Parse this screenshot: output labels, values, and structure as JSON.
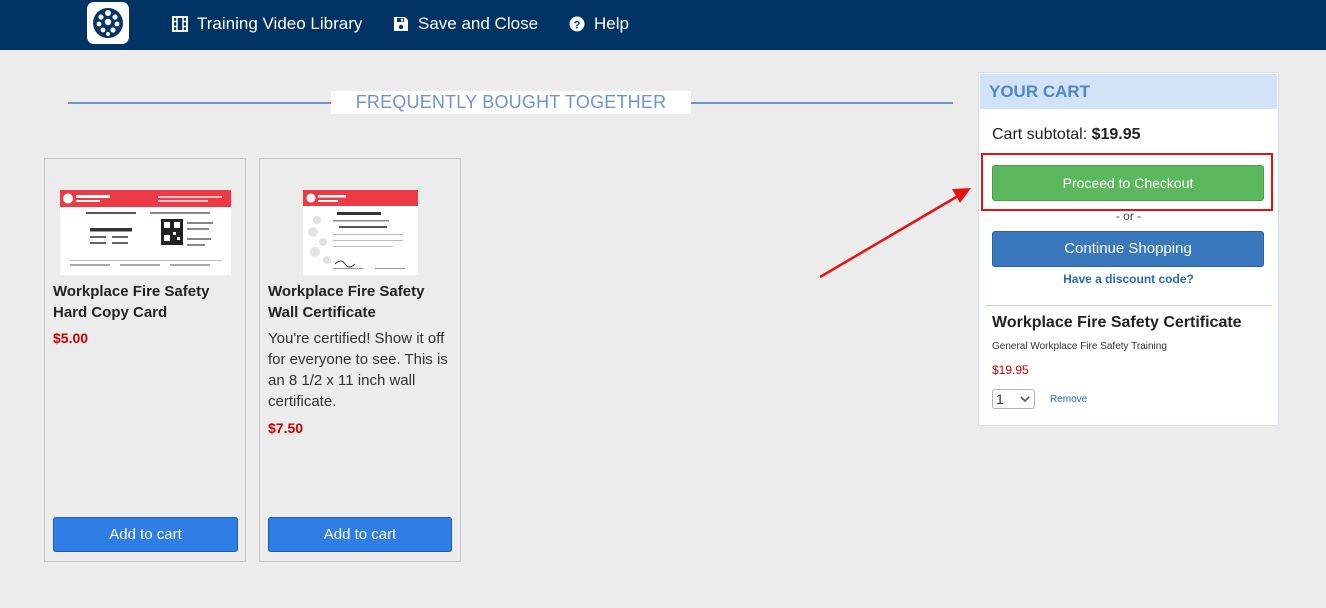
{
  "nav": {
    "items": [
      {
        "label": "Training Video Library",
        "icon": "film-icon"
      },
      {
        "label": "Save and Close",
        "icon": "floppy-disk-icon"
      },
      {
        "label": "Help",
        "icon": "question-circle-icon"
      }
    ]
  },
  "fbt": {
    "title": "FREQUENTLY BOUGHT TOGETHER"
  },
  "products": [
    {
      "name_line1": "Workplace Fire Safety",
      "name_line2": "Hard Copy Card",
      "description": "",
      "price": "$5.00",
      "button": "Add to cart"
    },
    {
      "name_line1": "Workplace Fire Safety",
      "name_line2": "Wall Certificate",
      "description": "You're certified! Show it off for everyone to see. This is an 8 1/2 x 11 inch wall certificate.",
      "price": "$7.50",
      "button": "Add to cart"
    }
  ],
  "cart": {
    "title": "YOUR CART",
    "subtotal_label": "Cart subtotal:",
    "subtotal_value": "$19.95",
    "checkout_button": "Proceed to Checkout",
    "or_text": "- or -",
    "continue_button": "Continue Shopping",
    "discount_link": "Have a discount code?",
    "item": {
      "name": "Workplace Fire Safety Certificate",
      "subtitle": "General Workplace Fire Safety Training",
      "price": "$19.95",
      "quantity": "1",
      "remove_label": "Remove"
    }
  },
  "colors": {
    "nav_bg": "#013464",
    "checkout_green": "#5cb85c",
    "continue_blue": "#3a78bd",
    "price_red": "#c40000",
    "annotation_red": "#ea1111"
  }
}
